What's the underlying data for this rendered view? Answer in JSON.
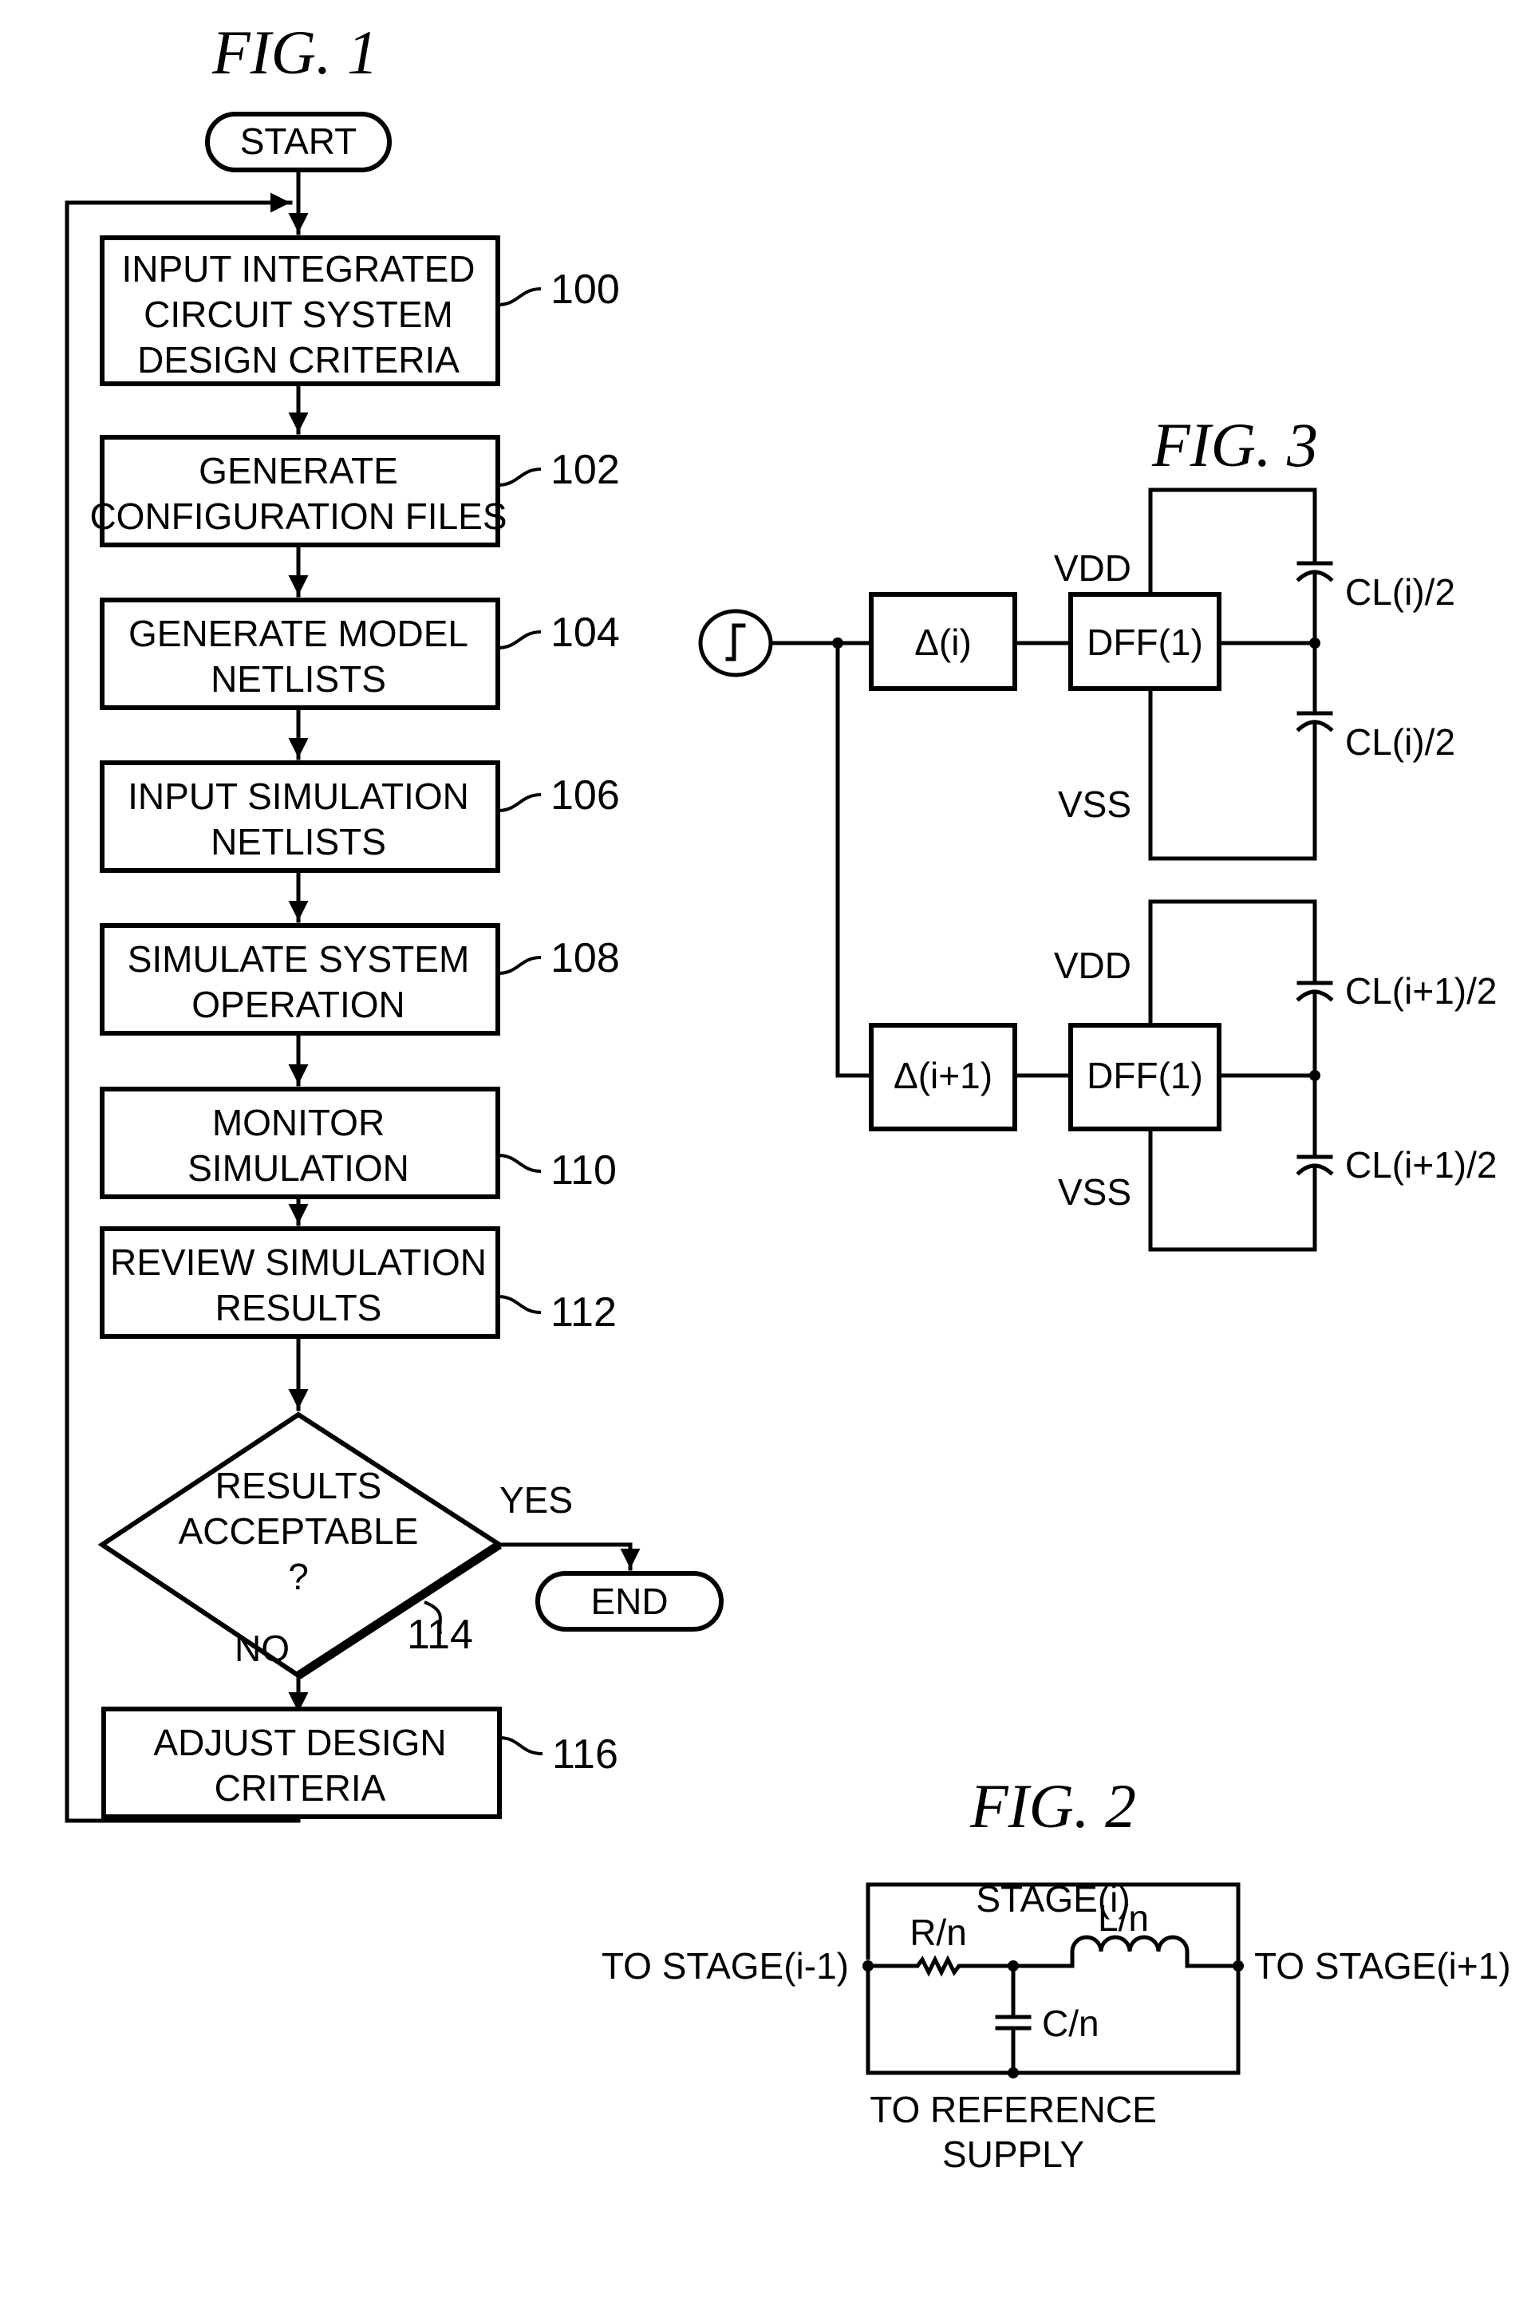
{
  "fig1": {
    "title": "FIG. 1",
    "start_label": "START",
    "end_label": "END",
    "steps": [
      {
        "ref": "100",
        "lines": [
          "INPUT INTEGRATED",
          "CIRCUIT SYSTEM",
          "DESIGN CRITERIA"
        ]
      },
      {
        "ref": "102",
        "lines": [
          "GENERATE",
          "CONFIGURATION FILES"
        ]
      },
      {
        "ref": "104",
        "lines": [
          "GENERATE MODEL",
          "NETLISTS"
        ]
      },
      {
        "ref": "106",
        "lines": [
          "INPUT SIMULATION",
          "NETLISTS"
        ]
      },
      {
        "ref": "108",
        "lines": [
          "SIMULATE SYSTEM",
          "OPERATION"
        ]
      },
      {
        "ref": "110",
        "lines": [
          "MONITOR",
          "SIMULATION"
        ]
      },
      {
        "ref": "112",
        "lines": [
          "REVIEW SIMULATION",
          "RESULTS"
        ]
      }
    ],
    "decision": {
      "ref": "114",
      "lines": [
        "RESULTS",
        "ACCEPTABLE",
        "?"
      ],
      "yes_label": "YES",
      "no_label": "NO"
    },
    "adjust": {
      "ref": "116",
      "lines": [
        "ADJUST DESIGN",
        "CRITERIA"
      ]
    }
  },
  "fig3": {
    "title": "FIG. 3",
    "stages": [
      {
        "delay_label": "Δ(i)",
        "dff_label": "DFF(1)",
        "vdd_label": "VDD",
        "vss_label": "VSS",
        "cap_top_label": "CL(i)/2",
        "cap_bottom_label": "CL(i)/2"
      },
      {
        "delay_label": "Δ(i+1)",
        "dff_label": "DFF(1)",
        "vdd_label": "VDD",
        "vss_label": "VSS",
        "cap_top_label": "CL(i+1)/2",
        "cap_bottom_label": "CL(i+1)/2"
      }
    ]
  },
  "fig2": {
    "title": "FIG. 2",
    "stage_label": "STAGE(i)",
    "left_label": "TO STAGE(i-1)",
    "right_label": "TO STAGE(i+1)",
    "resistor_label": "R/n",
    "inductor_label": "L/n",
    "capacitor_label": "C/n",
    "bottom_label_lines": [
      "TO REFERENCE",
      "SUPPLY"
    ]
  }
}
